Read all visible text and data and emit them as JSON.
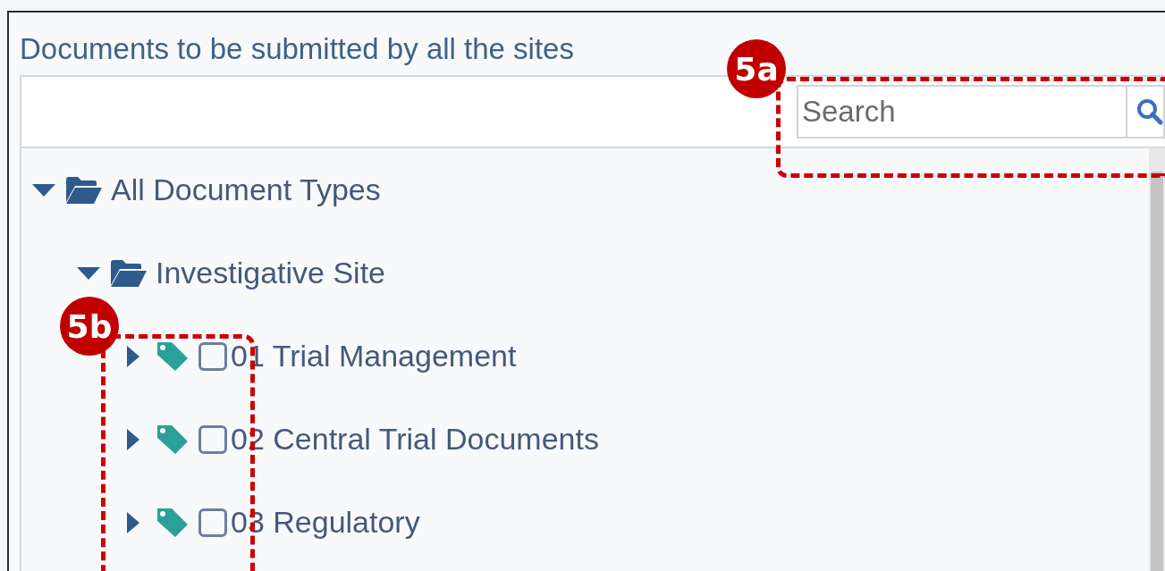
{
  "panel": {
    "title": "Documents to be submitted by all the sites"
  },
  "search": {
    "placeholder": "Search"
  },
  "tree": [
    {
      "label": "All Document Types",
      "kind": "folder",
      "expanded": true,
      "children": [
        {
          "label": "Investigative Site",
          "kind": "folder",
          "expanded": true,
          "children": [
            {
              "label": "01 Trial Management",
              "kind": "tag",
              "expanded": false,
              "checked": false
            },
            {
              "label": "02 Central Trial Documents",
              "kind": "tag",
              "expanded": false,
              "checked": false
            },
            {
              "label": "03 Regulatory",
              "kind": "tag",
              "expanded": false,
              "checked": false
            }
          ]
        }
      ]
    }
  ],
  "annotations": [
    {
      "label": "5a"
    },
    {
      "label": "5b"
    }
  ]
}
